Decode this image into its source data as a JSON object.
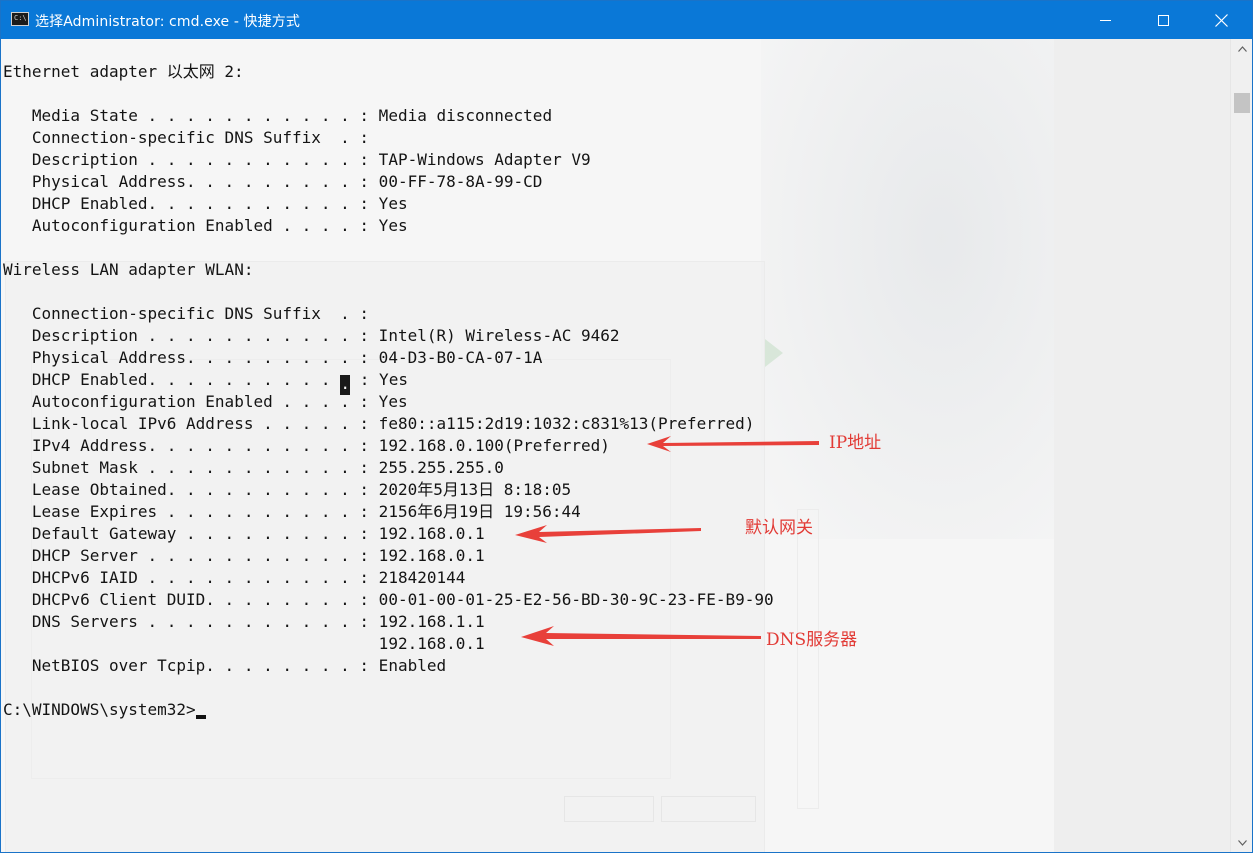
{
  "window": {
    "title": "选择Administrator: cmd.exe - 快捷方式",
    "icon": "cmd-icon",
    "controls": {
      "minimize": "minimize-icon",
      "maximize": "maximize-icon",
      "close": "close-icon"
    }
  },
  "terminal": {
    "lines": [
      "Ethernet adapter 以太网 2:",
      "",
      "   Media State . . . . . . . . . . . : Media disconnected",
      "   Connection-specific DNS Suffix  . :",
      "   Description . . . . . . . . . . . : TAP-Windows Adapter V9",
      "   Physical Address. . . . . . . . . : 00-FF-78-8A-99-CD",
      "   DHCP Enabled. . . . . . . . . . . : Yes",
      "   Autoconfiguration Enabled . . . . : Yes",
      "",
      "Wireless LAN adapter WLAN:",
      "",
      "   Connection-specific DNS Suffix  . :",
      "   Description . . . . . . . . . . . : Intel(R) Wireless-AC 9462",
      "   Physical Address. . . . . . . . . : 04-D3-B0-CA-07-1A",
      "   DHCP Enabled. . . . . . . . . . . : Yes",
      "   Autoconfiguration Enabled . . . . : Yes",
      "   Link-local IPv6 Address . . . . . : fe80::a115:2d19:1032:c831%13(Preferred)",
      "   IPv4 Address. . . . . . . . . . . : 192.168.0.100(Preferred)",
      "   Subnet Mask . . . . . . . . . . . : 255.255.255.0",
      "   Lease Obtained. . . . . . . . . . : 2020年5月13日 8:18:05",
      "   Lease Expires . . . . . . . . . . : 2156年6月19日 19:56:44",
      "   Default Gateway . . . . . . . . . : 192.168.0.1",
      "   DHCP Server . . . . . . . . . . . : 192.168.0.1",
      "   DHCPv6 IAID . . . . . . . . . . . : 218420144",
      "   DHCPv6 Client DUID. . . . . . . . : 00-01-00-01-25-E2-56-BD-30-9C-23-FE-B9-90",
      "   DNS Servers . . . . . . . . . . . : 192.168.1.1",
      "                                       192.168.0.1",
      "   NetBIOS over Tcpip. . . . . . . . : Enabled",
      "",
      "C:\\WINDOWS\\system32>"
    ],
    "selection_line": {
      "before": "   DHCP Enabled. . . . . . . . . . ",
      "selected": ".",
      "after": " : Yes"
    }
  },
  "annotations": {
    "ip": "IP地址",
    "gateway": "默认网关",
    "dns": "DNS服务器",
    "color": "#e23b36"
  },
  "colors": {
    "titlebar": "#0a78d7",
    "console_bg": "#f6f6f6",
    "text": "#141414"
  }
}
